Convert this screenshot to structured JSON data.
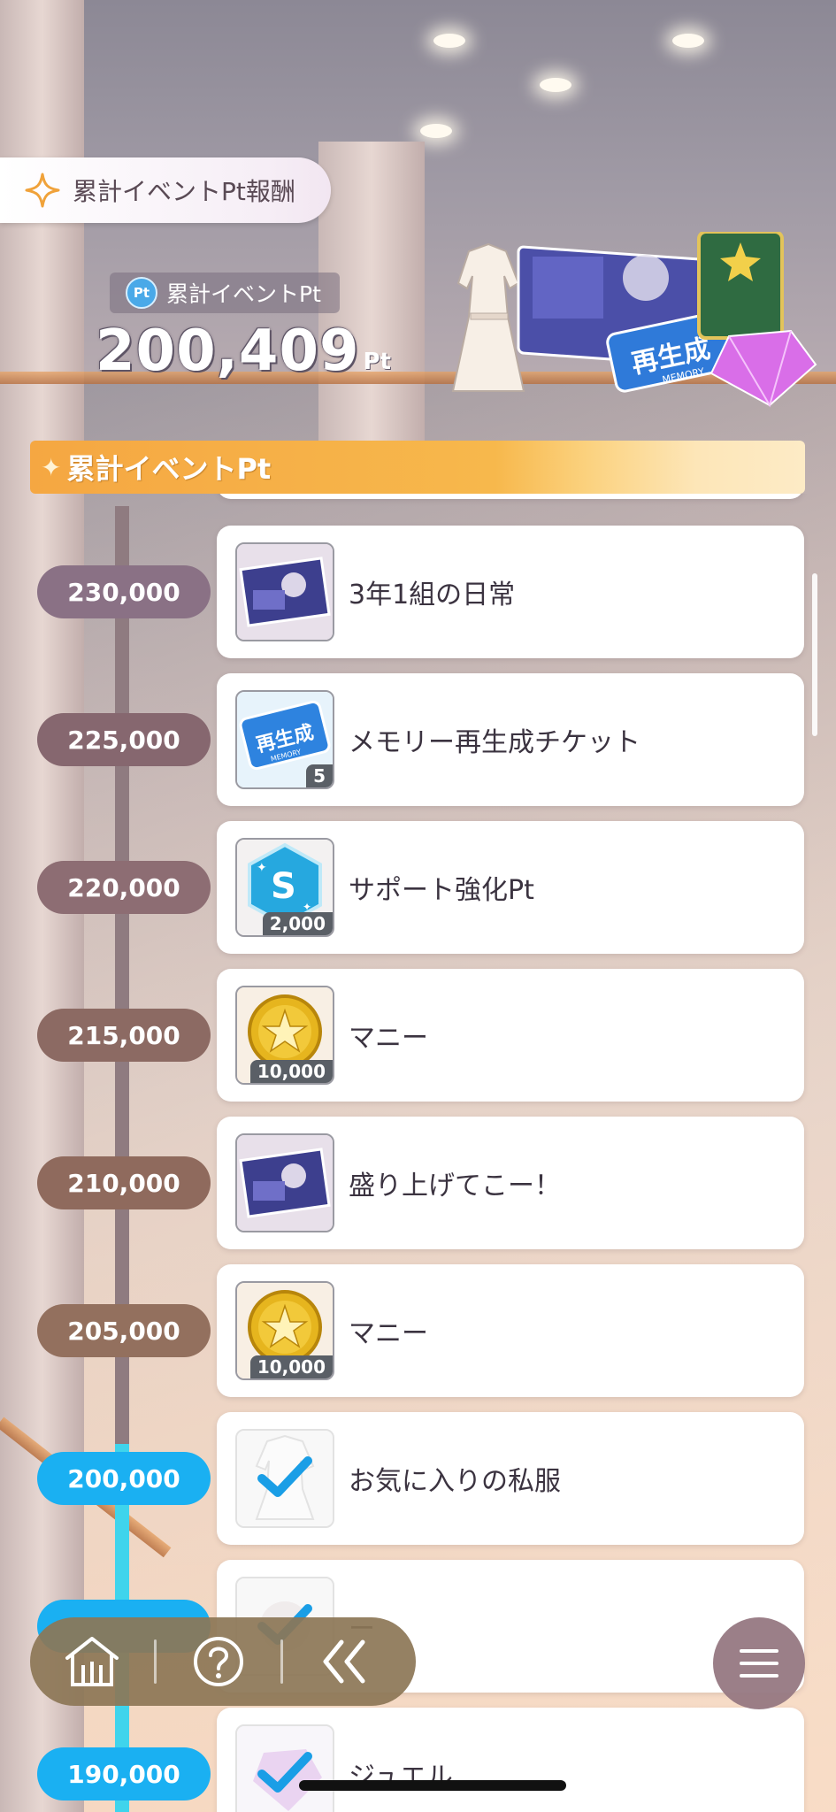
{
  "header": {
    "title": "累計イベントPt報酬"
  },
  "points": {
    "label": "累計イベントPt",
    "value": "200,409",
    "unit": "Pt",
    "icon_text": "Pt"
  },
  "preview_ticket": {
    "label": "再生成",
    "sub": "MEMORY"
  },
  "section": {
    "title": "累計イベントPt"
  },
  "rewards": [
    {
      "points": "230,000",
      "name": "3年1組の日常",
      "quantity": "",
      "claimed": false,
      "icon": "memory-card-icon",
      "color": "#8a7185"
    },
    {
      "points": "225,000",
      "name": "メモリー再生成チケット",
      "quantity": "5",
      "claimed": false,
      "icon": "regenerate-ticket-icon",
      "color": "#86676f",
      "ticket_label": "再生成",
      "ticket_sub": "MEMORY"
    },
    {
      "points": "220,000",
      "name": "サポート強化Pt",
      "quantity": "2,000",
      "claimed": false,
      "icon": "support-pt-icon",
      "color": "#8d6d73",
      "badge_letter": "S"
    },
    {
      "points": "215,000",
      "name": "マニー",
      "quantity": "10,000",
      "claimed": false,
      "icon": "money-coin-icon",
      "color": "#8c6a63"
    },
    {
      "points": "210,000",
      "name": "盛り上げてこー！",
      "quantity": "",
      "claimed": false,
      "icon": "memory-card-icon",
      "color": "#8f6a5d"
    },
    {
      "points": "205,000",
      "name": "マニー",
      "quantity": "10,000",
      "claimed": false,
      "icon": "money-coin-icon",
      "color": "#93705e"
    },
    {
      "points": "200,000",
      "name": "お気に入りの私服",
      "quantity": "",
      "claimed": true,
      "icon": "costume-icon",
      "color": "#1ab0f2"
    },
    {
      "points": "",
      "name": "ー",
      "quantity": "",
      "claimed": true,
      "icon": "item-icon",
      "color": "#1ab0f2"
    },
    {
      "points": "190,000",
      "name": "ジュエル",
      "quantity": "",
      "claimed": true,
      "icon": "jewel-icon",
      "color": "#1ab0f2"
    }
  ],
  "colors": {
    "accent_orange": "#f5a742",
    "claimed_blue": "#1ab0f2",
    "check_blue": "#1a9ee6"
  }
}
